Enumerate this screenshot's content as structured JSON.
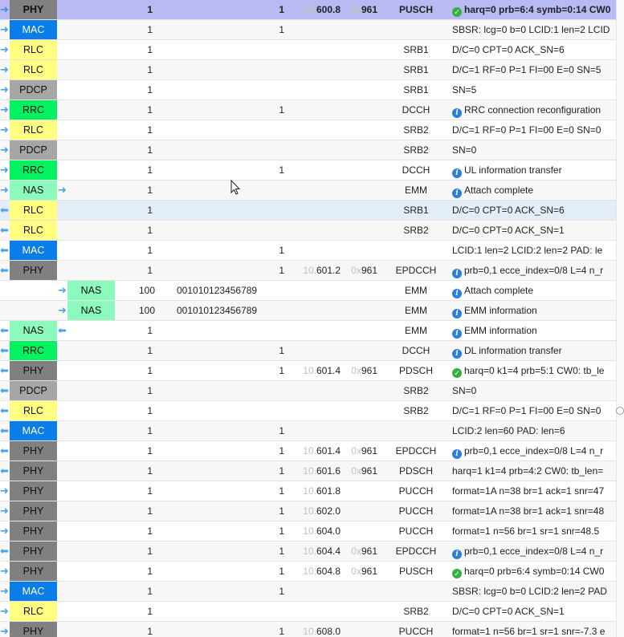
{
  "colors": {
    "PHY": "#808080",
    "MAC": "#0b7de8",
    "RLC": "#fffe80",
    "PDCP": "#a6a6a6",
    "RRC": "#04f260",
    "NAS": "#8cf9bd",
    "selected_row": "#b9b9f3",
    "hover_row": "#e3edf7",
    "arrow": "#4aa3e8"
  },
  "icons": {
    "in_arrow": "right-arrow-icon",
    "out_arrow": "left-arrow-icon",
    "info": "info-icon",
    "ok": "check-icon"
  },
  "rows": [
    {
      "dir": "in",
      "layer": "PHY",
      "ue": "1",
      "cell": "1",
      "time": {
        "hi": "10.",
        "lo": "600.8"
      },
      "rnti": {
        "hi": "0x",
        "lo": "961"
      },
      "channel": "PUSCH",
      "icon": "ok",
      "info": "harq=0 prb=6:4 symb=0:14 CW0",
      "selected": true
    },
    {
      "dir": "in",
      "layer": "MAC",
      "ue": "1",
      "cell": "1",
      "channel": "",
      "info": "SBSR: lcg=0 b=0 LCID:1 len=2 LCID"
    },
    {
      "dir": "in",
      "layer": "RLC",
      "ue": "1",
      "channel": "SRB1",
      "info": "D/C=0 CPT=0 ACK_SN=6"
    },
    {
      "dir": "in",
      "layer": "RLC",
      "ue": "1",
      "channel": "SRB1",
      "info": "D/C=1 RF=0 P=1 FI=00 E=0 SN=5"
    },
    {
      "dir": "in",
      "layer": "PDCP",
      "ue": "1",
      "channel": "SRB1",
      "info": "SN=5"
    },
    {
      "dir": "in",
      "layer": "RRC",
      "ue": "1",
      "cell": "1",
      "channel": "DCCH",
      "icon": "info",
      "info": "RRC connection reconfiguration"
    },
    {
      "dir": "in",
      "layer": "RLC",
      "ue": "1",
      "channel": "SRB2",
      "info": "D/C=1 RF=0 P=1 FI=00 E=0 SN=0"
    },
    {
      "dir": "in",
      "layer": "PDCP",
      "ue": "1",
      "channel": "SRB2",
      "info": "SN=0"
    },
    {
      "dir": "in",
      "layer": "RRC",
      "ue": "1",
      "cell": "1",
      "channel": "DCCH",
      "icon": "info",
      "info": "UL information transfer"
    },
    {
      "dir": "in",
      "layer": "NAS",
      "ue": "1",
      "channel": "EMM",
      "icon": "info",
      "info": "Attach complete",
      "arrow_after": "in"
    },
    {
      "dir": "out",
      "layer": "RLC",
      "ue": "1",
      "channel": "SRB1",
      "info": "D/C=0 CPT=0 ACK_SN=6",
      "hover": true
    },
    {
      "dir": "out",
      "layer": "RLC",
      "ue": "1",
      "channel": "SRB2",
      "info": "D/C=0 CPT=0 ACK_SN=1"
    },
    {
      "dir": "out",
      "layer": "MAC",
      "ue": "1",
      "cell": "1",
      "channel": "",
      "info": "LCID:1 len=2 LCID:2 len=2 PAD: le"
    },
    {
      "dir": "out",
      "layer": "PHY",
      "ue": "1",
      "cell": "1",
      "time": {
        "hi": "10.",
        "lo": "601.2"
      },
      "rnti": {
        "hi": "0x",
        "lo": "961"
      },
      "channel": "EPDCCH",
      "icon": "info",
      "info": "prb=0,1 ecce_index=0/8 L=4 n_r"
    },
    {
      "dir": "in",
      "layer": "NAS",
      "indent": true,
      "ue": "100",
      "imsi": "001010123456789",
      "channel": "EMM",
      "icon": "info",
      "info": "Attach complete"
    },
    {
      "dir": "in",
      "layer": "NAS",
      "indent": true,
      "ue": "100",
      "imsi": "001010123456789",
      "channel": "EMM",
      "icon": "info",
      "info": "EMM information"
    },
    {
      "dir": "out",
      "layer": "NAS",
      "ue": "1",
      "channel": "EMM",
      "icon": "info",
      "info": "EMM information",
      "arrow_after": "out"
    },
    {
      "dir": "out",
      "layer": "RRC",
      "ue": "1",
      "cell": "1",
      "channel": "DCCH",
      "icon": "info",
      "info": "DL information transfer"
    },
    {
      "dir": "out",
      "layer": "PHY",
      "ue": "1",
      "cell": "1",
      "time": {
        "hi": "10.",
        "lo": "601.4"
      },
      "rnti": {
        "hi": "0x",
        "lo": "961"
      },
      "channel": "PDSCH",
      "icon": "ok",
      "info": "harq=0 k1=4 prb=5:1 CW0: tb_le"
    },
    {
      "dir": "out",
      "layer": "PDCP",
      "ue": "1",
      "channel": "SRB2",
      "info": "SN=0"
    },
    {
      "dir": "out",
      "layer": "RLC",
      "ue": "1",
      "channel": "SRB2",
      "info": "D/C=1 RF=0 P=1 FI=00 E=0 SN=0"
    },
    {
      "dir": "out",
      "layer": "MAC",
      "ue": "1",
      "cell": "1",
      "channel": "",
      "info": "LCID:2 len=60 PAD: len=6"
    },
    {
      "dir": "out",
      "layer": "PHY",
      "ue": "1",
      "cell": "1",
      "time": {
        "hi": "10.",
        "lo": "601.4"
      },
      "rnti": {
        "hi": "0x",
        "lo": "961"
      },
      "channel": "EPDCCH",
      "icon": "info",
      "info": "prb=0,1 ecce_index=0/8 L=4 n_r"
    },
    {
      "dir": "out",
      "layer": "PHY",
      "ue": "1",
      "cell": "1",
      "time": {
        "hi": "10.",
        "lo": "601.6"
      },
      "rnti": {
        "hi": "0x",
        "lo": "961"
      },
      "channel": "PDSCH",
      "info": "harq=1 k1=4 prb=4:2 CW0: tb_len="
    },
    {
      "dir": "in",
      "layer": "PHY",
      "ue": "1",
      "cell": "1",
      "time": {
        "hi": "10.",
        "lo": "601.8"
      },
      "channel": "PUCCH",
      "info": "format=1A n=38 br=1 ack=1 snr=47"
    },
    {
      "dir": "in",
      "layer": "PHY",
      "ue": "1",
      "cell": "1",
      "time": {
        "hi": "10.",
        "lo": "602.0"
      },
      "channel": "PUCCH",
      "info": "format=1A n=38 br=1 ack=1 snr=48"
    },
    {
      "dir": "in",
      "layer": "PHY",
      "ue": "1",
      "cell": "1",
      "time": {
        "hi": "10.",
        "lo": "604.0"
      },
      "channel": "PUCCH",
      "info": "format=1 n=56 br=1 sr=1 snr=48.5"
    },
    {
      "dir": "out",
      "layer": "PHY",
      "ue": "1",
      "cell": "1",
      "time": {
        "hi": "10.",
        "lo": "604.4"
      },
      "rnti": {
        "hi": "0x",
        "lo": "961"
      },
      "channel": "EPDCCH",
      "icon": "info",
      "info": "prb=0,1 ecce_index=0/8 L=4 n_r"
    },
    {
      "dir": "in",
      "layer": "PHY",
      "ue": "1",
      "cell": "1",
      "time": {
        "hi": "10.",
        "lo": "604.8"
      },
      "rnti": {
        "hi": "0x",
        "lo": "961"
      },
      "channel": "PUSCH",
      "icon": "ok",
      "info": "harq=0 prb=6:4 symb=0:14 CW0"
    },
    {
      "dir": "in",
      "layer": "MAC",
      "ue": "1",
      "cell": "1",
      "channel": "",
      "info": "SBSR: lcg=0 b=0 LCID:2 len=2 PAD"
    },
    {
      "dir": "in",
      "layer": "RLC",
      "ue": "1",
      "channel": "SRB2",
      "info": "D/C=0 CPT=0 ACK_SN=1"
    },
    {
      "dir": "in",
      "layer": "PHY",
      "ue": "1",
      "cell": "1",
      "time": {
        "hi": "10.",
        "lo": "608.0"
      },
      "channel": "PUCCH",
      "info": "format=1 n=56 br=1 sr=1 snr=-7.3 e"
    }
  ]
}
